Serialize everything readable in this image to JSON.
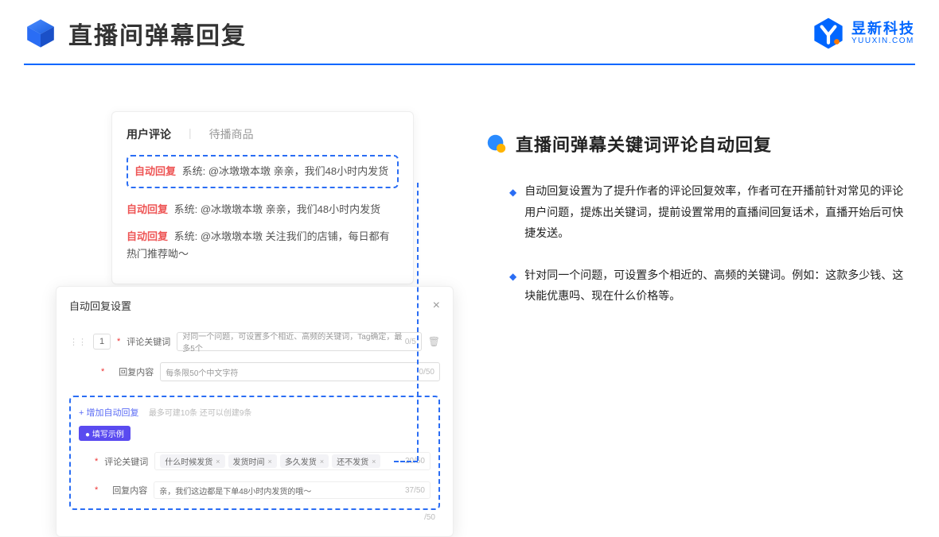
{
  "header": {
    "title": "直播间弹幕回复",
    "brand_cn": "昱新科技",
    "brand_en": "YUUXIN.COM"
  },
  "comments_panel": {
    "tab_active": "用户评论",
    "tab_inactive": "待播商品",
    "msgs": [
      {
        "tag": "自动回复",
        "text": "系统: @冰墩墩本墩 亲亲，我们48小时内发货"
      },
      {
        "tag": "自动回复",
        "text": "系统: @冰墩墩本墩 亲亲，我们48小时内发货"
      },
      {
        "tag": "自动回复",
        "text": "系统: @冰墩墩本墩 关注我们的店铺，每日都有热门推荐呦～"
      }
    ]
  },
  "settings_panel": {
    "title": "自动回复设置",
    "idx": "1",
    "label_keyword": "评论关键词",
    "label_reply": "回复内容",
    "placeholder_keyword": "对同一个问题，可设置多个相近、高频的关键词，Tag确定，最多5个",
    "count_keyword": "0/5",
    "placeholder_reply": "每条限50个中文字符",
    "count_reply": "0/50",
    "add_link": "+ 增加自动回复",
    "add_hint": "最多可建10条 还可以创建9条",
    "badge": "● 填写示例",
    "ex_keyword_label": "评论关键词",
    "ex_tags": [
      "什么时候发货",
      "发货时间",
      "多久发货",
      "还不发货"
    ],
    "ex_kw_count": "20/50",
    "ex_reply_label": "回复内容",
    "ex_reply_value": "亲，我们这边都是下单48小时内发货的哦～",
    "ex_reply_count": "37/50",
    "below_count": "/50"
  },
  "right": {
    "heading": "直播间弹幕关键词评论自动回复",
    "p1": "自动回复设置为了提升作者的评论回复效率，作者可在开播前针对常见的评论用户问题，提炼出关键词，提前设置常用的直播间回复话术，直播开始后可快捷发送。",
    "p2": "针对同一个问题，可设置多个相近的、高频的关键词。例如：这款多少钱、这块能优惠吗、现在什么价格等。"
  }
}
